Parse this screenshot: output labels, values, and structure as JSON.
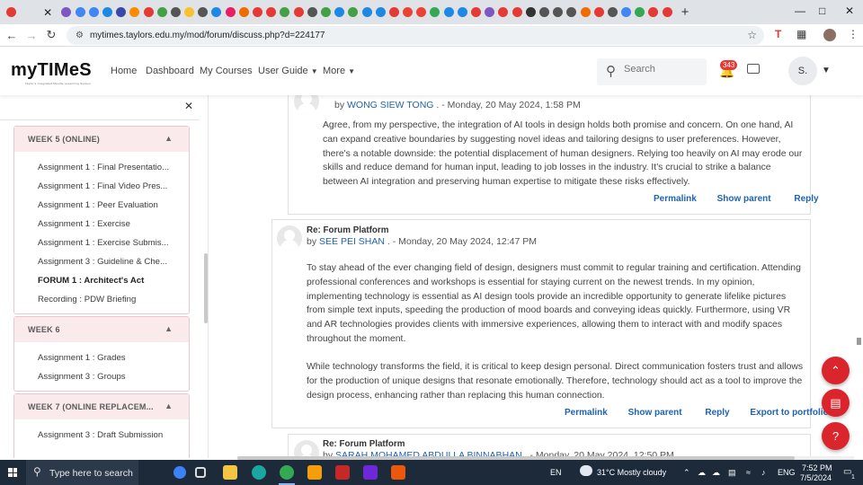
{
  "browser": {
    "url": "mytimes.taylors.edu.my/mod/forum/discuss.php?d=224177",
    "tab_colors": [
      "#e53935",
      "#7e57c2",
      "#4285f4",
      "#4285f4",
      "#1e88e5",
      "#3949ab",
      "#fb8c00",
      "#e53935",
      "#43a047",
      "#555555",
      "#fbc02d",
      "#555555",
      "#1e88e5",
      "#e91e63",
      "#ef6c00",
      "#e53935",
      "#e53935",
      "#43a047",
      "#e53935",
      "#555555",
      "#43a047",
      "#1e88e5",
      "#43a047",
      "#1e88e5",
      "#1e88e5",
      "#e53935",
      "#ea4335",
      "#ea4335",
      "#34a853",
      "#1e88e5",
      "#1e88e5",
      "#e53935",
      "#7e57c2",
      "#e53935",
      "#e53935",
      "#333333",
      "#555555",
      "#555555",
      "#555555",
      "#ef6c00",
      "#e53935",
      "#555555",
      "#4285f4",
      "#34a853",
      "#e53935",
      "#e53935"
    ]
  },
  "site": {
    "logo_text": "myTIMeS",
    "logo_tagline": "Taylor's Integrated Moodle eLearning System",
    "nav": [
      "Home",
      "Dashboard",
      "My Courses",
      "User Guide",
      "More"
    ],
    "search_placeholder": "Search",
    "notification_count": "343",
    "avatar_initials": "S."
  },
  "drawer": {
    "sections": [
      {
        "title": "WEEK 5 (ONLINE)",
        "items": [
          "Assignment 1 : Final Presentatio...",
          "Assignment 1 : Final Video Pres...",
          "Assignment 1 : Peer Evaluation",
          "Assignment 1 : Exercise",
          "Assignment 1 : Exercise Submis...",
          "Assignment 3 : Guideline & Che...",
          "FORUM 1 : Architect's Act",
          "Recording : PDW Briefing"
        ]
      },
      {
        "title": "WEEK 6",
        "items": [
          "Assignment 1 : Grades",
          "Assignment 3 : Groups"
        ]
      },
      {
        "title": "WEEK 7 (ONLINE REPLACEM...",
        "items": [
          "Assignment 3 : Draft Submission"
        ]
      }
    ]
  },
  "posts": [
    {
      "author": "WONG SIEW TONG",
      "date": " . - Monday, 20 May 2024, 1:58 PM",
      "by": "by ",
      "text": "Agree, from my perspective, the integration of AI tools in design holds both promise and concern. On one hand, AI can expand creative boundaries by suggesting novel ideas and tailoring designs to user preferences. However, there's a notable downside: the potential displacement of human designers. Relying too heavily on AI may erode our skills and reduce demand for human input, leading to job losses in the industry. It's crucial to strike a balance between AI integration and preserving human expertise to mitigate these risks effectively.",
      "actions": [
        "Permalink",
        "Show parent",
        "Reply"
      ]
    },
    {
      "subject": "Re: Forum Platform",
      "by": "by ",
      "author": "SEE PEI SHAN",
      "date": " . - Monday, 20 May 2024, 12:47 PM",
      "para1": "To stay ahead of the ever changing field of design, designers must commit to regular training and certification. Attending professional conferences and workshops is essential for staying current on the newest trends. In my opinion, implementing technology is essential as AI design tools provide an incredible opportunity to generate lifelike pictures from simple text inputs, speeding the production of mood boards and conveying ideas quickly. Furthermore, using VR and AR technologies provides clients with immersive experiences, allowing them to interact with and modify spaces throughout the moment.",
      "para2": "While technology transforms the field, it is critical to keep design personal. Direct communication fosters trust and allows for the production of unique designs that resonate emotionally. Therefore, technology should act as a tool to improve the design process, enhancing rather than replacing this human connection.",
      "actions": [
        "Permalink",
        "Show parent",
        "Reply",
        "Export to portfolio"
      ]
    },
    {
      "subject": "Re: Forum Platform",
      "by": "by ",
      "author": "SARAH MOHAMED ABDULLA BINNABHAN",
      "date": " . - Monday, 20 May 2024, 12:50 PM"
    }
  ],
  "taskbar": {
    "search_placeholder": "Type here to search",
    "language": "EN",
    "weather": "31°C  Mostly cloudy",
    "input_lang": "ENG",
    "time": "7:52 PM",
    "date": "7/5/2024",
    "notif_count": "1"
  }
}
